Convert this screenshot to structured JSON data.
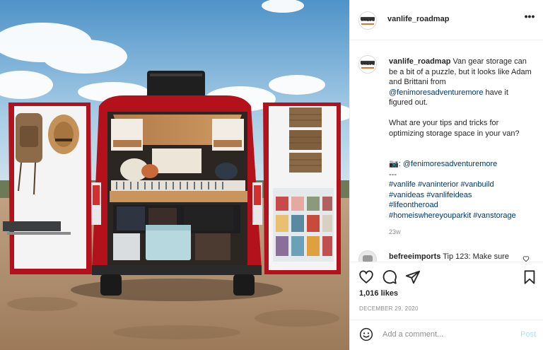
{
  "header": {
    "username": "vanlife_roadmap",
    "avatar_text": "VANLIFE",
    "more_icon": "ellipsis-icon"
  },
  "caption": {
    "username": "vanlife_roadmap",
    "text1": "Van gear storage can be a bit of a puzzle, but it looks like Adam and Brittani from",
    "mention": "@fenimoresadventuremore",
    "text2": "have it figured out.",
    "question": "What are your tips and tricks for optimizing storage space in your van?",
    "camera_prefix": "📷:",
    "camera_mention": "@fenimoresadventuremore",
    "dashes": "---",
    "hashtags_line1": "#vanlife #vaninterior #vanbuild",
    "hashtags_line2": "#vanideas #vanlifeideas",
    "hashtags_line3": "#lifeontheroad",
    "hashtags_line4": "#homeiswhereyouparkit #vanstorage",
    "time_ago": "23w"
  },
  "comment2": {
    "username": "befreeimports",
    "text": "Tip 123: Make sure"
  },
  "actions": {
    "like_icon": "heart-icon",
    "comment_icon": "comment-icon",
    "share_icon": "share-icon",
    "save_icon": "bookmark-icon",
    "likes": "1,016 likes",
    "date": "DECEMBER 29, 2020"
  },
  "add_comment": {
    "placeholder": "Add a comment...",
    "post_label": "Post"
  },
  "colors": {
    "link": "#00376b",
    "muted": "#8e8e8e",
    "post_disabled": "#b2dffc",
    "van_red": "#b3121c"
  }
}
